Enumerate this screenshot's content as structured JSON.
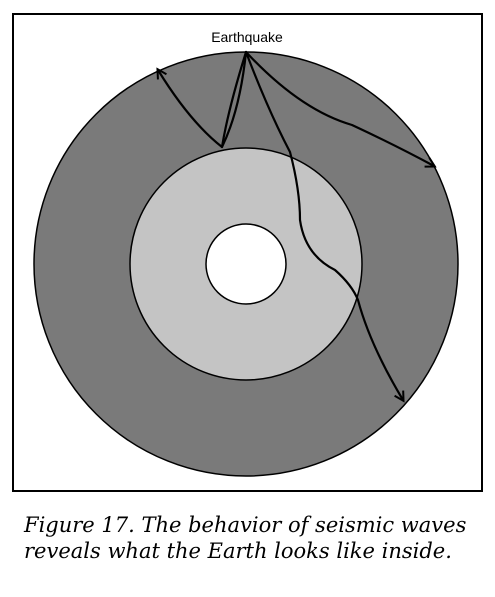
{
  "diagram": {
    "earthquake_label": "Earthquake",
    "colors": {
      "mantle": "#7a7a7a",
      "outer_core": "#c4c4c4",
      "inner_core": "#ffffff",
      "outline": "#000000",
      "wave_path": "#000000"
    },
    "icons": {
      "wave_arrowhead": "arrow-head-icon"
    }
  },
  "caption": {
    "text": "Figure 17. The behavior of seismic waves reveals what the Earth looks like inside."
  }
}
